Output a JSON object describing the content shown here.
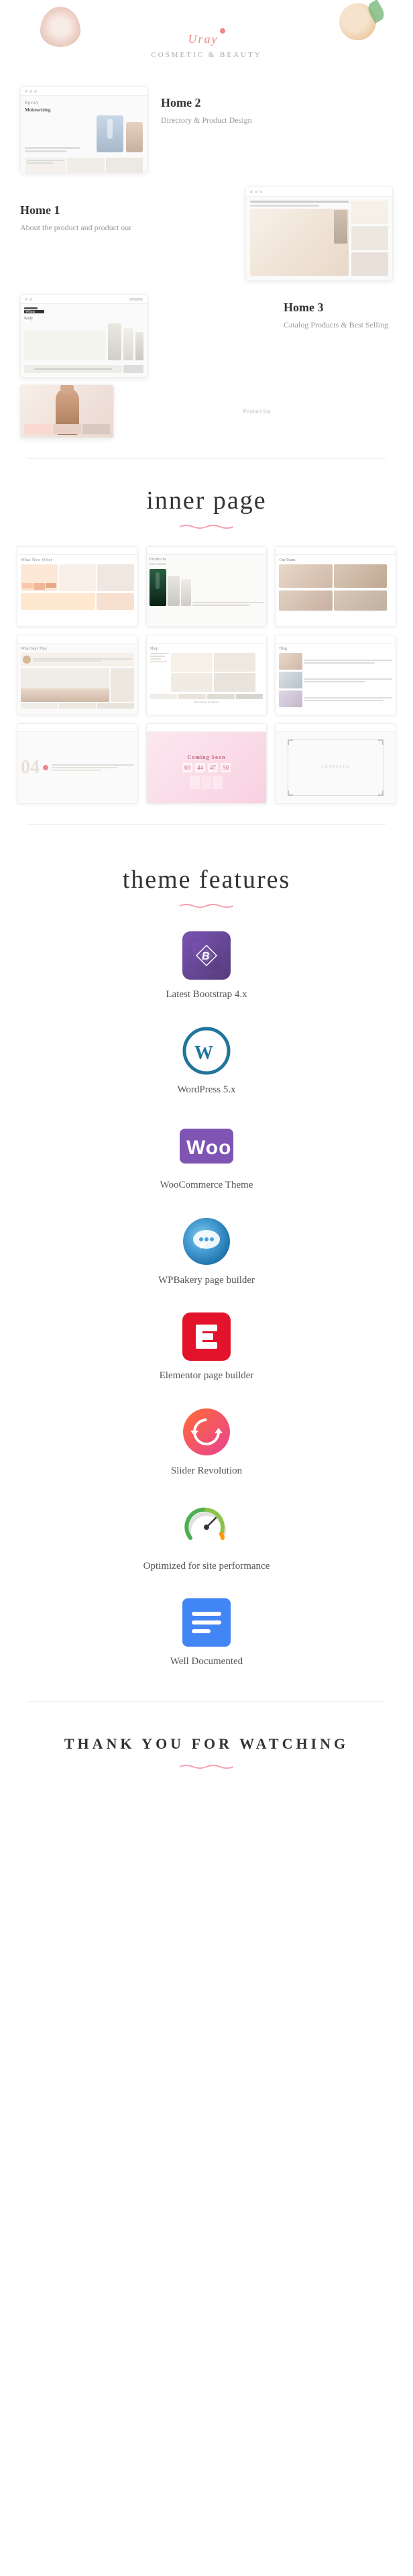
{
  "brand": {
    "name": "Uray",
    "dot": "•",
    "subtitle": "Cosmetic & Beauty"
  },
  "demos": [
    {
      "id": "home1",
      "title": "Home 1",
      "description": "About the product and product our",
      "position": "right"
    },
    {
      "id": "home2",
      "title": "Home 2",
      "description": "Directory & Product Design",
      "position": "right"
    },
    {
      "id": "home3",
      "title": "Home 3",
      "description": "Catalog Products & Best Selling",
      "position": "right"
    }
  ],
  "sections": {
    "inner_page": {
      "title": "inner page",
      "wavy_color": "#f4a0b0"
    },
    "theme_features": {
      "title": "theme features",
      "wavy_color": "#f4a0b0"
    }
  },
  "features": [
    {
      "id": "bootstrap",
      "label": "Latest Bootstrap 4.x",
      "icon_type": "bootstrap"
    },
    {
      "id": "wordpress",
      "label": "WordPress 5.x",
      "icon_type": "wordpress"
    },
    {
      "id": "woocommerce",
      "label": "WooCommerce Theme",
      "icon_type": "woo"
    },
    {
      "id": "wpbakery",
      "label": "WPBakery page builder",
      "icon_type": "wpbakery"
    },
    {
      "id": "elementor",
      "label": "Elementor page builder",
      "icon_type": "elementor"
    },
    {
      "id": "slider_revolution",
      "label": "Slider Revolution",
      "icon_type": "slider_rev"
    },
    {
      "id": "optimized",
      "label": "Optimized for site performance",
      "icon_type": "optimized"
    },
    {
      "id": "documented",
      "label": "Well Documented",
      "icon_type": "documented"
    }
  ],
  "thankyou": {
    "text": "THANK YOU FOR WATCHING"
  },
  "inner_pages": [
    {
      "id": "shop-offer",
      "type": "shop-offer"
    },
    {
      "id": "products-natural",
      "type": "products-natural"
    },
    {
      "id": "our-team",
      "type": "our-team"
    },
    {
      "id": "what-says",
      "type": "what-says"
    },
    {
      "id": "shop-page",
      "type": "shop-page"
    },
    {
      "id": "blog",
      "type": "blog"
    },
    {
      "id": "page-04",
      "type": "page-04"
    },
    {
      "id": "coming-soon",
      "type": "coming-soon"
    },
    {
      "id": "corner-lines",
      "type": "corner-lines"
    }
  ]
}
